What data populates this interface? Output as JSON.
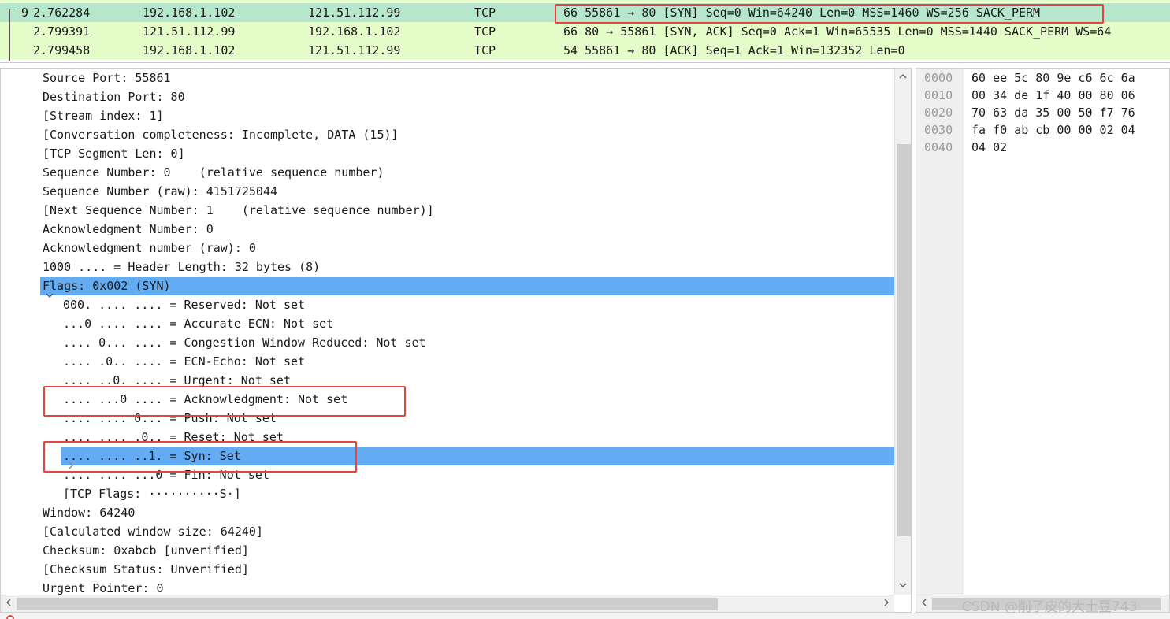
{
  "packets": [
    {
      "no": "9",
      "time": "2.762284",
      "source": "192.168.1.102",
      "destination": "121.51.112.99",
      "protocol": "TCP",
      "info": "66 55861 → 80 [SYN] Seq=0 Win=64240 Len=0 MSS=1460 WS=256 SACK_PERM",
      "selected": true
    },
    {
      "no": "",
      "time": "2.799391",
      "source": "121.51.112.99",
      "destination": "192.168.1.102",
      "protocol": "TCP",
      "info": "66 80 → 55861 [SYN, ACK] Seq=0 Ack=1 Win=65535 Len=0 MSS=1440 SACK_PERM WS=64"
    },
    {
      "no": "",
      "time": "2.799458",
      "source": "192.168.1.102",
      "destination": "121.51.112.99",
      "protocol": "TCP",
      "info": "54 55861 → 80 [ACK] Seq=1 Ack=1 Win=132352 Len=0"
    }
  ],
  "details": [
    "Source Port: 55861",
    "Destination Port: 80",
    "[Stream index: 1]",
    "[Conversation completeness: Incomplete, DATA (15)]",
    "[TCP Segment Len: 0]",
    "Sequence Number: 0    (relative sequence number)",
    "Sequence Number (raw): 4151725044",
    "[Next Sequence Number: 1    (relative sequence number)]",
    "Acknowledgment Number: 0",
    "Acknowledgment number (raw): 0",
    "1000 .... = Header Length: 32 bytes (8)",
    "Flags: 0x002 (SYN)",
    "000. .... .... = Reserved: Not set",
    "...0 .... .... = Accurate ECN: Not set",
    ".... 0... .... = Congestion Window Reduced: Not set",
    ".... .0.. .... = ECN-Echo: Not set",
    ".... ..0. .... = Urgent: Not set",
    ".... ...0 .... = Acknowledgment: Not set",
    ".... .... 0... = Push: Not set",
    ".... .... .0.. = Reset: Not set",
    ".... .... ..1. = Syn: Set",
    ".... .... ...0 = Fin: Not set",
    "[TCP Flags: ··········S·]",
    "Window: 64240",
    "[Calculated window size: 64240]",
    "Checksum: 0xabcb [unverified]",
    "[Checksum Status: Unverified]",
    "Urgent Pointer: 0"
  ],
  "bytes": [
    {
      "offset": "0000",
      "hex": "60 ee 5c 80 9e c6 6c 6a"
    },
    {
      "offset": "0010",
      "hex": "00 34 de 1f 40 00 80 06"
    },
    {
      "offset": "0020",
      "hex": "70 63 da 35 00 50 f7 76"
    },
    {
      "offset": "0030",
      "hex": "fa f0 ab cb 00 00 02 04"
    },
    {
      "offset": "0040",
      "hex": "04 02"
    }
  ],
  "icons": {
    "expanded": "chevron-down-icon",
    "collapsed": "chevron-right-icon",
    "scroll_up": "scroll-up-icon",
    "scroll_down": "scroll-down-icon",
    "scroll_left": "scroll-left-icon",
    "scroll_right": "scroll-right-icon"
  },
  "colors": {
    "selected_packet": "#b6e7cc",
    "tcp_packet": "#e4fcc8",
    "highlight": "#63acf4",
    "annotation": "#e8443b"
  },
  "watermark": "CSDN @削了皮的大土豆743"
}
